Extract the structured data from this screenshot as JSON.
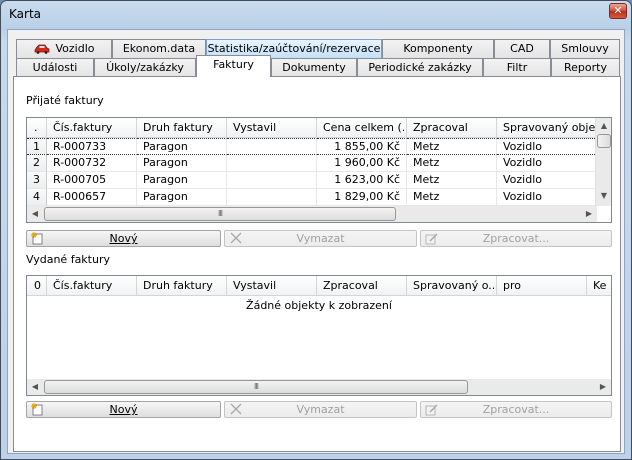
{
  "window": {
    "title": "Karta",
    "close_glyph": "✕"
  },
  "tabs_row1": [
    {
      "label": "Vozidlo",
      "icon": "car-icon"
    },
    {
      "label": "Ekonom.data"
    },
    {
      "label": "Statistika/zaúčtování/rezervace"
    },
    {
      "label": "Komponenty"
    },
    {
      "label": "CAD"
    },
    {
      "label": "Smlouvy"
    }
  ],
  "tabs_row2": [
    {
      "label": "Události"
    },
    {
      "label": "Úkoly/zakázky"
    },
    {
      "label": "Faktury"
    },
    {
      "label": "Dokumenty"
    },
    {
      "label": "Periodické zakázky"
    },
    {
      "label": "Filtr"
    },
    {
      "label": "Reporty"
    }
  ],
  "received": {
    "label": "Přijaté faktury",
    "columns": [
      ".",
      "Čís.faktury",
      "Druh faktury",
      "Vystavil",
      "Cena celkem (...",
      "Zpracoval",
      "Spravovaný objekt"
    ],
    "rows": [
      {
        "n": "1",
        "cislo": "R-000733",
        "druh": "Paragon",
        "vystavil": "",
        "cena": "1 855,00 Kč",
        "zpracoval": "Metz",
        "objekt": "Vozidlo"
      },
      {
        "n": "2",
        "cislo": "R-000732",
        "druh": "Paragon",
        "vystavil": "",
        "cena": "1 960,00 Kč",
        "zpracoval": "Metz",
        "objekt": "Vozidlo"
      },
      {
        "n": "3",
        "cislo": "R-000705",
        "druh": "Paragon",
        "vystavil": "",
        "cena": "1 623,00 Kč",
        "zpracoval": "Metz",
        "objekt": "Vozidlo"
      },
      {
        "n": "4",
        "cislo": "R-000657",
        "druh": "Paragon",
        "vystavil": "",
        "cena": "1 829,00 Kč",
        "zpracoval": "Metz",
        "objekt": "Vozidlo"
      }
    ],
    "buttons": {
      "new": "Nový",
      "delete": "Vymazat",
      "process": "Zpracovat..."
    }
  },
  "issued": {
    "label": "Vydané faktury",
    "columns": [
      "0",
      "Čís.faktury",
      "Druh faktury",
      "Vystavil",
      "Zpracoval",
      "Spravovaný o...",
      "pro",
      "Ke"
    ],
    "empty_text": "Žádné objekty k zobrazení",
    "buttons": {
      "new": "Nový",
      "delete": "Vymazat",
      "process": "Zpracovat..."
    }
  },
  "scroll": {
    "thumb_grip": "III",
    "left": "◀",
    "right": "▶",
    "up": "▲",
    "down": "▼"
  },
  "colors": {
    "tab_highlight": "#c3e0f8",
    "window_frame": "#b9d0e8",
    "close_red": "#cf4e36"
  }
}
